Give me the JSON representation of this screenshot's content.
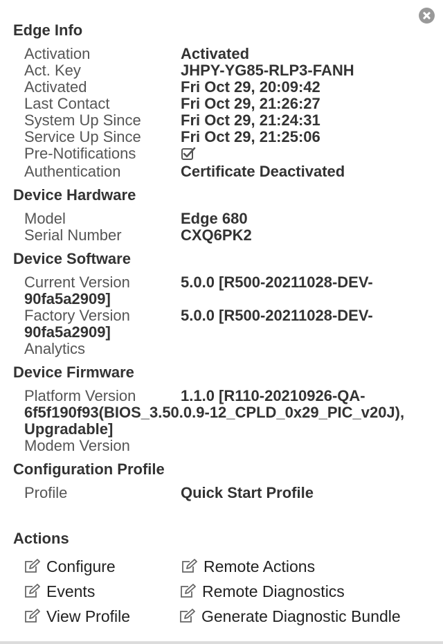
{
  "edge_info": {
    "title": "Edge Info",
    "rows": [
      {
        "label": "Activation",
        "value": "Activated"
      },
      {
        "label": "Act. Key",
        "value": "JHPY-YG85-RLP3-FANH"
      },
      {
        "label": "Activated",
        "value": "Fri Oct 29, 20:09:42"
      },
      {
        "label": "Last Contact",
        "value": "Fri Oct 29, 21:26:27"
      },
      {
        "label": "System Up Since",
        "value": "Fri Oct 29, 21:24:31"
      },
      {
        "label": "Service Up Since",
        "value": "Fri Oct 29, 21:25:06"
      },
      {
        "label": "Pre-Notifications",
        "value": "",
        "icon": "checkbox-checked-icon"
      },
      {
        "label": "Authentication",
        "value": "Certificate Deactivated"
      }
    ]
  },
  "device_hardware": {
    "title": "Device Hardware",
    "rows": [
      {
        "label": "Model",
        "value": "Edge 680"
      },
      {
        "label": "Serial Number",
        "value": "CXQ6PK2"
      }
    ]
  },
  "device_software": {
    "title": "Device Software",
    "rows": [
      {
        "label": "Current Version",
        "value_bold": "5.0.0",
        "value_plain": " [R500-20211028-DEV-90fa5a2909]"
      },
      {
        "label": "Factory Version",
        "value_bold": "5.0.0",
        "value_plain": " [R500-20211028-DEV-90fa5a2909]"
      },
      {
        "label": "Analytics",
        "value": ""
      }
    ]
  },
  "device_firmware": {
    "title": "Device Firmware",
    "rows": [
      {
        "label": "Platform Version",
        "value_bold": "1.1.0",
        "value_plain": " [R110-20210926-QA-6f5f190f93(BIOS_3.50.0.9-12_CPLD_0x29_PIC_v20J), Upgradable]"
      },
      {
        "label": "Modem Version",
        "value": ""
      }
    ]
  },
  "configuration_profile": {
    "title": "Configuration Profile",
    "rows": [
      {
        "label": "Profile",
        "value": "Quick Start Profile"
      }
    ]
  },
  "actions": {
    "title": "Actions",
    "items": [
      {
        "label": "Configure",
        "icon": "edit-icon"
      },
      {
        "label": "Remote Actions",
        "icon": "edit-icon"
      },
      {
        "label": "Events",
        "icon": "edit-icon"
      },
      {
        "label": "Remote Diagnostics",
        "icon": "edit-icon"
      },
      {
        "label": "View Profile",
        "icon": "edit-icon"
      },
      {
        "label": "Generate Diagnostic Bundle",
        "icon": "edit-icon"
      }
    ]
  },
  "colors": {
    "heading": "#333333",
    "label": "#555555",
    "close_button": "#999999"
  }
}
